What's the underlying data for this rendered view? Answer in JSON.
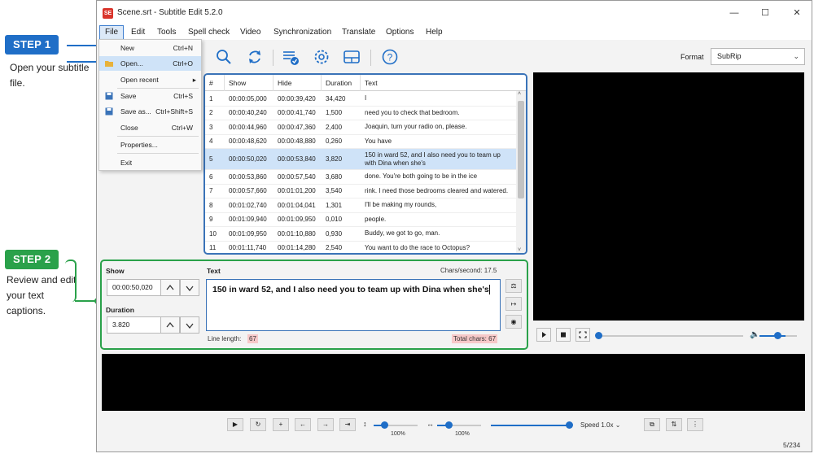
{
  "callouts": {
    "step1": {
      "badge": "STEP 1",
      "text": "Open your subtitle file.",
      "color": "#1f6ec7"
    },
    "step2": {
      "badge": "STEP 2",
      "text": "Review and edit your text captions.",
      "color": "#2aa14a"
    }
  },
  "window": {
    "app_icon": "SE",
    "title": "Scene.srt - Subtitle Edit 5.2.0",
    "controls": [
      "minimize-icon",
      "maximize-icon",
      "close-icon"
    ]
  },
  "menubar": [
    "File",
    "Edit",
    "Tools",
    "Spell check",
    "Video",
    "Synchronization",
    "Translate",
    "Options",
    "Help"
  ],
  "file_menu": {
    "items": [
      {
        "label": "New",
        "shortcut": "Ctrl+N",
        "icon": ""
      },
      {
        "label": "Open...",
        "shortcut": "Ctrl+O",
        "icon": "folder-icon",
        "highlighted": true
      },
      {
        "label": "Open recent",
        "shortcut": "",
        "icon": "",
        "submenu": true
      },
      {
        "label": "Save",
        "shortcut": "Ctrl+S",
        "icon": "save-icon"
      },
      {
        "label": "Save as...",
        "shortcut": "Ctrl+Shift+S",
        "icon": "save-as-icon"
      },
      {
        "label": "Close",
        "shortcut": "Ctrl+W",
        "icon": ""
      },
      {
        "label": "Properties...",
        "shortcut": "",
        "icon": ""
      },
      {
        "label": "Exit",
        "shortcut": "",
        "icon": ""
      }
    ]
  },
  "toolbar": {
    "icons": [
      "search-icon",
      "sync-icon",
      "spellcheck-icon",
      "settings-icon",
      "layout-icon",
      "help-icon"
    ],
    "format_label": "Format",
    "format_value": "SubRip"
  },
  "grid": {
    "columns": [
      "#",
      "Show",
      "Hide",
      "Duration",
      "Text"
    ],
    "rows": [
      {
        "n": "1",
        "show": "00:00:05,000",
        "hide": "00:00:39,420",
        "dur": "34,420",
        "text": "I"
      },
      {
        "n": "2",
        "show": "00:00:40,240",
        "hide": "00:00:41,740",
        "dur": "1,500",
        "text": "need you to check that bedroom."
      },
      {
        "n": "3",
        "show": "00:00:44,960",
        "hide": "00:00:47,360",
        "dur": "2,400",
        "text": "Joaquin, turn your radio on, please."
      },
      {
        "n": "4",
        "show": "00:00:48,620",
        "hide": "00:00:48,880",
        "dur": "0,260",
        "text": "You have"
      },
      {
        "n": "5",
        "show": "00:00:50,020",
        "hide": "00:00:53,840",
        "dur": "3,820",
        "text": "150 in ward 52, and I also need you to team up with Dina when she's",
        "selected": true
      },
      {
        "n": "6",
        "show": "00:00:53,860",
        "hide": "00:00:57,540",
        "dur": "3,680",
        "text": "done. You're both going to be in the ice"
      },
      {
        "n": "7",
        "show": "00:00:57,660",
        "hide": "00:01:01,200",
        "dur": "3,540",
        "text": "rink. I need those bedrooms cleared and watered."
      },
      {
        "n": "8",
        "show": "00:01:02,740",
        "hide": "00:01:04,041",
        "dur": "1,301",
        "text": "I'll be making my rounds,"
      },
      {
        "n": "9",
        "show": "00:01:09,940",
        "hide": "00:01:09,950",
        "dur": "0,010",
        "text": "people."
      },
      {
        "n": "10",
        "show": "00:01:09,950",
        "hide": "00:01:10,880",
        "dur": "0,930",
        "text": "Buddy, we got to go, man."
      },
      {
        "n": "11",
        "show": "00:01:11,740",
        "hide": "00:01:14,280",
        "dur": "2,540",
        "text": "You want to do the race to Octopus?"
      }
    ]
  },
  "editor": {
    "show_label": "Show",
    "show_value": "00:00:50,020",
    "duration_label": "Duration",
    "duration_value": "3.820",
    "text_label": "Text",
    "chars_per_second": "Chars/second: 17.5",
    "text_value": "150 in ward 52, and I also need you to team up with Dina when she's",
    "line_length_label": "Line length:",
    "line_length_value": "67",
    "total_chars": "Total chars: 67"
  },
  "video_controls": {
    "volume_level": 0.7,
    "position": 0.0
  },
  "waveform_controls": {
    "zoom_v": "100%",
    "zoom_h": "100%",
    "speed": "Speed 1.0x"
  },
  "status": {
    "counter": "5/234"
  }
}
